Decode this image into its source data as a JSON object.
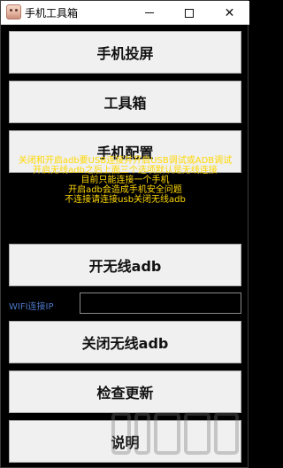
{
  "window": {
    "title": "手机工具箱",
    "controls": {
      "minimize_icon": "minimize-icon",
      "maximize_icon": "maximize-icon",
      "close_glyph": "✕"
    }
  },
  "buttons": {
    "screen_mirror": "手机投屏",
    "toolbox": "工具箱",
    "phone_config": "手机配置",
    "enable_wireless_adb": "开无线adb",
    "disable_wireless_adb": "关闭无线adb",
    "check_update": "检查更新",
    "help": "说明"
  },
  "notice": {
    "lines": [
      "关闭和开启adb要USB连接并开启USB调试或ADB调试",
      "开启无线adb之后上面三个选项默认是无线连接",
      "目前只能连接一个手机",
      "开启adb会造成手机安全问题",
      "不连接请连接usb关闭无线adb"
    ],
    "color": "#ffd800"
  },
  "wifi": {
    "label": "WIFI连接IP",
    "value": "",
    "label_color": "#4b78c8"
  },
  "colors": {
    "background": "#000000",
    "button_face": "#f0f0f0"
  }
}
